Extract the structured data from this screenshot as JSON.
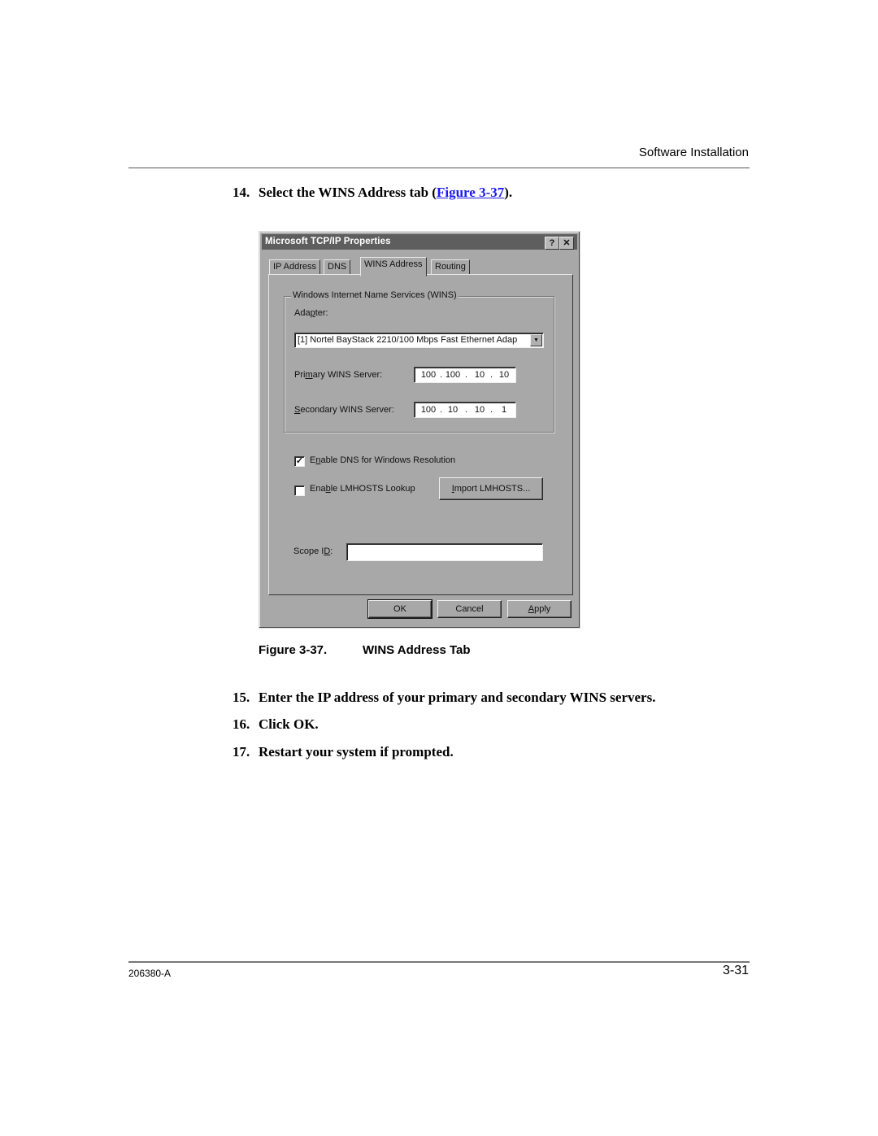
{
  "page": {
    "running_head": "Software Installation",
    "footer_doc_id": "206380-A",
    "footer_page": "3-31"
  },
  "steps": [
    {
      "num": "14.",
      "text_before": "Select the WINS Address tab (",
      "link": "Figure 3-37",
      "text_after": ")."
    },
    {
      "num": "15.",
      "text": "Enter the IP address of your primary and secondary WINS servers."
    },
    {
      "num": "16.",
      "text": "Click OK."
    },
    {
      "num": "17.",
      "text": "Restart your system if prompted."
    }
  ],
  "figure_caption": {
    "number": "Figure 3-37.",
    "title": "WINS Address Tab"
  },
  "colors": {
    "link": "#1a1aee",
    "dialog_face": "#a8a8a8",
    "titlebar": "#5e5e5e"
  },
  "dialog": {
    "title": "Microsoft TCP/IP Properties",
    "help_icon": "?",
    "close_icon": "✕",
    "tabs": [
      {
        "label": "IP Address",
        "active": false
      },
      {
        "label": "DNS",
        "active": false
      },
      {
        "label": "WINS Address",
        "active": true
      },
      {
        "label": "Routing",
        "active": false
      }
    ],
    "group_label": "Windows Internet Name Services (WINS)",
    "adapter_label_pre": "Ada",
    "adapter_label_u": "p",
    "adapter_label_post": "ter:",
    "adapter_value": "[1]  Nortel BayStack 2210/100  Mbps Fast Ethernet Adap",
    "dropdown_icon": "▼",
    "primary_label_pre": "Pri",
    "primary_label_u": "m",
    "primary_label_post": "ary WINS Server:",
    "primary_ip": [
      "100",
      "100",
      "10",
      "10"
    ],
    "secondary_label_u": "S",
    "secondary_label_post": "econdary WINS Server:",
    "secondary_ip": [
      "100",
      "10",
      "10",
      "1"
    ],
    "enable_dns": {
      "pre": "E",
      "u": "n",
      "post": "able DNS for Windows Resolution",
      "checked": true,
      "mark": "✓"
    },
    "enable_lmhosts": {
      "pre": "Ena",
      "u": "b",
      "post": "le LMHOSTS Lookup",
      "checked": false
    },
    "import_button": {
      "u": "I",
      "post": "mport LMHOSTS..."
    },
    "scope_label_pre": "Scope I",
    "scope_label_u": "D",
    "scope_label_post": ":",
    "scope_value": "",
    "ok_label": "OK",
    "cancel_label": "Cancel",
    "apply_u": "A",
    "apply_post": "pply"
  }
}
